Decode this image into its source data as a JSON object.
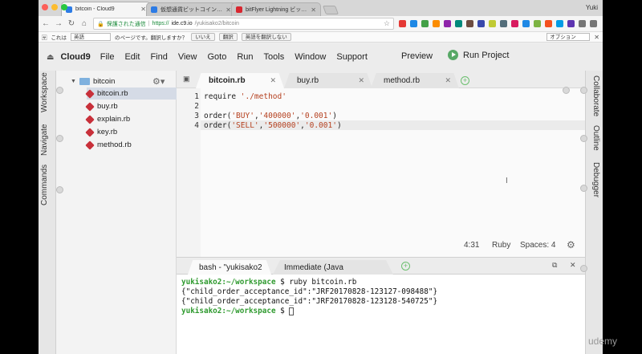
{
  "browser": {
    "tabs": [
      {
        "title": "bitcoin - Cloud9",
        "color": "#2c7be5",
        "active": true
      },
      {
        "title": "仮想通貨ビットコイン（Bitcoin）",
        "color": "#2c7be5",
        "active": false
      },
      {
        "title": "bitFlyer Lightning ビットコイン",
        "color": "#d8262f",
        "active": false
      }
    ],
    "profile": "Yuki",
    "secure_label": "保護された通信",
    "url_scheme": "https://",
    "url_host": "ide.c9.io",
    "url_path": "/yukisako2/bitcoin"
  },
  "translate": {
    "prefix": "これは",
    "lang": "英語",
    "question": "のページです。翻訳しますか？",
    "no": "いいえ",
    "translate": "翻訳",
    "never": "英語を翻訳しない",
    "options": "オプション"
  },
  "menu": {
    "brand": "Cloud9",
    "items": [
      "File",
      "Edit",
      "Find",
      "View",
      "Goto",
      "Run",
      "Tools",
      "Window",
      "Support"
    ],
    "preview": "Preview",
    "run": "Run Project"
  },
  "side_left": [
    "Workspace",
    "Navigate",
    "Commands"
  ],
  "side_right": [
    "Collaborate",
    "Outline",
    "Debugger"
  ],
  "tree": {
    "root": "bitcoin",
    "files": [
      "bitcoin.rb",
      "buy.rb",
      "explain.rb",
      "key.rb",
      "method.rb"
    ]
  },
  "editor": {
    "tabs": [
      "bitcoin.rb",
      "buy.rb",
      "method.rb"
    ],
    "lines": [
      {
        "n": "1",
        "text": "require './method'"
      },
      {
        "n": "2",
        "text": ""
      },
      {
        "n": "3",
        "text": "order('BUY','400000','0.001')"
      },
      {
        "n": "4",
        "text": "order('SELL','500000','0.001')"
      }
    ],
    "position": "4:31",
    "language": "Ruby",
    "spaces": "Spaces: 4"
  },
  "terminal": {
    "tabs": [
      "bash - \"yukisako2",
      "Immediate (Java"
    ],
    "prompt": "yukisako2:~/workspace",
    "command": " $ ruby bitcoin.rb",
    "output": [
      "{\"child_order_acceptance_id\":\"JRF20170828-123127-098488\"}",
      "{\"child_order_acceptance_id\":\"JRF20170828-123128-540725\"}"
    ],
    "prompt_end": " $ "
  },
  "watermark": "udemy"
}
